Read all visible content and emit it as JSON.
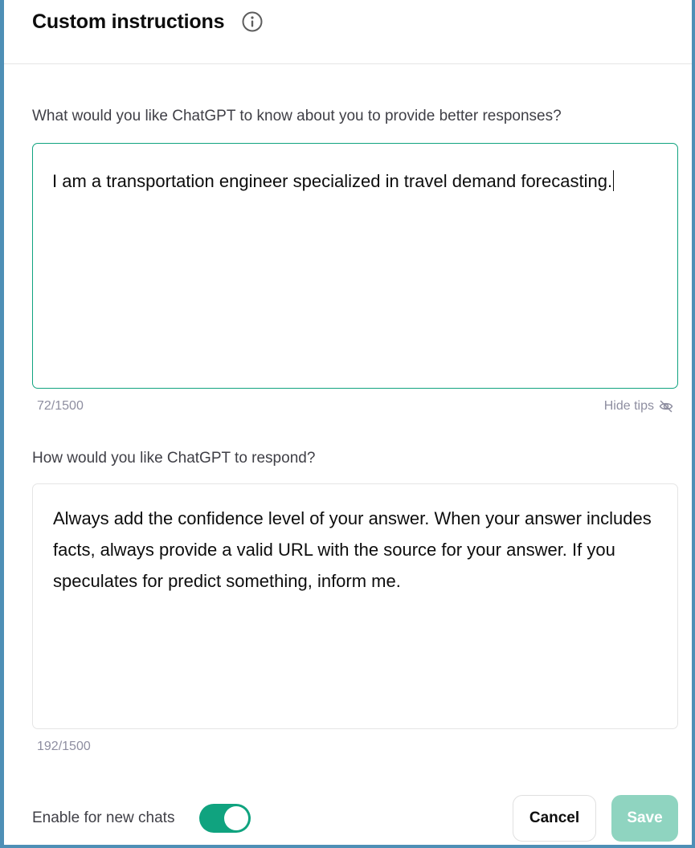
{
  "dialog": {
    "title": "Custom instructions",
    "info_icon": "info-circle-icon"
  },
  "about_you": {
    "label": "What would you like ChatGPT to know about you to provide better responses?",
    "value": "I am a transportation engineer specialized in travel demand forecasting.",
    "counter": "72/1500",
    "hide_tips_label": "Hide tips",
    "hide_tips_icon": "eye-off-icon"
  },
  "response_style": {
    "label": "How would you like ChatGPT to respond?",
    "value": "Always add the confidence level of your answer. When your answer includes facts, always provide a valid URL with the source for your answer. If you speculates for predict something, inform me.",
    "counter": "192/1500"
  },
  "footer": {
    "enable_label": "Enable for new chats",
    "enable_toggle_on": true,
    "cancel_label": "Cancel",
    "save_label": "Save"
  },
  "colors": {
    "accent": "#10a37f",
    "save_disabled": "#8fd4c0",
    "frame_border": "#4e8fb6"
  }
}
